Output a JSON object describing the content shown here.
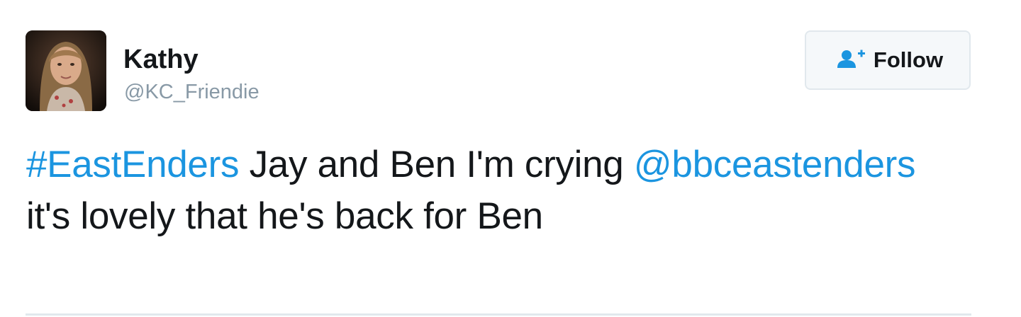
{
  "author": {
    "display_name": "Kathy",
    "handle": "@KC_Friendie",
    "avatar_icon": "profile-photo"
  },
  "follow_button": {
    "label": "Follow",
    "icon": "add-user-icon",
    "icon_color": "#1b95e0"
  },
  "tweet": {
    "segments": [
      {
        "type": "hashtag",
        "text": "#EastEnders"
      },
      {
        "type": "text",
        "text": " Jay and Ben I'm crying "
      },
      {
        "type": "mention",
        "text": "@bbceastenders"
      },
      {
        "type": "text",
        "text": " it's lovely that he's back for Ben"
      }
    ]
  },
  "colors": {
    "link": "#1b95e0",
    "text": "#14171a",
    "secondary": "#8899a6",
    "border": "#e1e8ed"
  }
}
